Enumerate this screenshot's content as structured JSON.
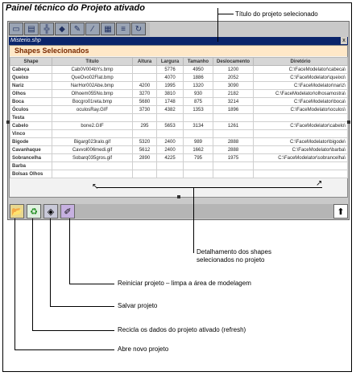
{
  "caption": "Painel técnico do Projeto ativado",
  "window_title": "Misterio.shp",
  "close_label": "x",
  "section_header": "Shapes Selecionados",
  "columns": [
    "Shape",
    "Título",
    "Altura",
    "Largura",
    "Tamanho",
    "Deslocamento",
    "Diretório"
  ],
  "rows": [
    [
      "Cabeça",
      "Cab0V004bYs.bmp",
      "",
      "5776",
      "4950",
      "1200",
      "C:\\FaceModelator\\cabeca\\"
    ],
    [
      "Queixo",
      "QueOvo02Flat.bmp",
      "",
      "4070",
      "1886",
      "2052",
      "C:\\FaceModelator\\queixo\\"
    ],
    [
      "Nariz",
      "NarHor002Abe.bmp",
      "4200",
      "1995",
      "1320",
      "3090",
      "C:\\FaceModelator\\nariz\\"
    ],
    [
      "Olhos",
      "Olhoem055No.bmp",
      "3270",
      "3810",
      "930",
      "2182",
      "C:\\FaceModelator\\olhosamostra\\"
    ],
    [
      "Boca",
      "Bocgro01reta.bmp",
      "5680",
      "1748",
      "875",
      "3214",
      "C:\\FaceModelator\\boca\\"
    ],
    [
      "Óculos",
      "oculosRay.GIF",
      "3730",
      "4382",
      "1353",
      "1896",
      "C:\\FaceModelator\\oculos\\"
    ],
    [
      "Testa",
      "",
      "",
      "",
      "",
      "",
      ""
    ],
    [
      "Cabelo",
      "bone2.GIF",
      "295",
      "5653",
      "3134",
      "1261",
      "C:\\FaceModelator\\cabelo\\"
    ],
    [
      "Vinco",
      "",
      "",
      "",
      "",
      "",
      ""
    ],
    [
      "Bigode",
      "Bigarg023ralo.gif",
      "5320",
      "2400",
      "989",
      "2888",
      "C:\\FaceModelator\\bigode\\"
    ],
    [
      "Cavanhaque",
      "Cavvol006medi.gif",
      "5612",
      "2400",
      "1662",
      "2888",
      "C:\\FaceModelator\\barba\\"
    ],
    [
      "Sobrancelha",
      "Sobarq035gros.gif",
      "2890",
      "4225",
      "795",
      "1975",
      "C:\\FaceModelator\\sobrancelha\\"
    ],
    [
      "Barba",
      "",
      "",
      "",
      "",
      "",
      ""
    ],
    [
      "Bolsas Olhos",
      "",
      "",
      "",
      "",
      "",
      ""
    ]
  ],
  "callouts": {
    "titulo": "Título do projeto selecionado",
    "detalhamento_1": "Detalhamento dos shapes",
    "detalhamento_2": "selecionados no projeto",
    "reiniciar": "Reiniciar projeto – limpa a área de modelagem",
    "salvar": "Salvar projeto",
    "recicla": "Recicla os dados do projeto ativado (refresh)",
    "abre": "Abre novo projeto"
  },
  "toolbar_icons": [
    "folder-icon",
    "printer-icon",
    "grid-icon",
    "paint-icon",
    "tools-icon",
    "pencil-icon",
    "chart-icon",
    "align-icon",
    "rotate-icon"
  ]
}
